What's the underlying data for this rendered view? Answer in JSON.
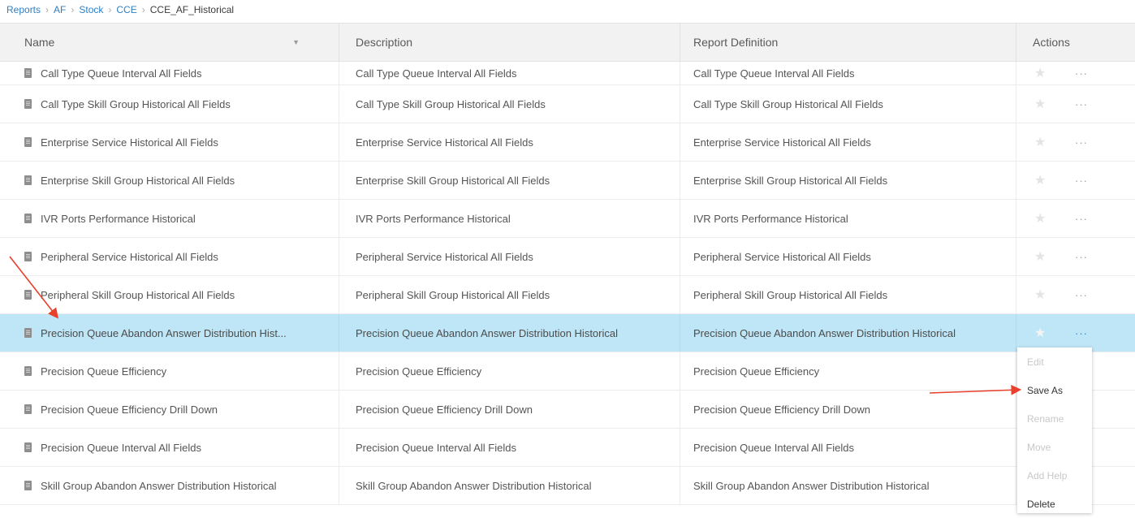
{
  "breadcrumb": {
    "items": [
      "Reports",
      "AF",
      "Stock",
      "CCE"
    ],
    "current": "CCE_AF_Historical",
    "separator": "›"
  },
  "table": {
    "headers": {
      "name": "Name",
      "description": "Description",
      "definition": "Report Definition",
      "actions": "Actions"
    },
    "rows": [
      {
        "name": "Call Type Queue Interval All Fields",
        "description": "Call Type Queue Interval All Fields",
        "definition": "Call Type Queue Interval All Fields"
      },
      {
        "name": "Call Type Skill Group Historical All Fields",
        "description": "Call Type Skill Group Historical All Fields",
        "definition": "Call Type Skill Group Historical All Fields"
      },
      {
        "name": "Enterprise Service Historical All Fields",
        "description": "Enterprise Service Historical All Fields",
        "definition": "Enterprise Service Historical All Fields"
      },
      {
        "name": "Enterprise Skill Group Historical All Fields",
        "description": "Enterprise Skill Group Historical All Fields",
        "definition": "Enterprise Skill Group Historical All Fields"
      },
      {
        "name": "IVR Ports Performance Historical",
        "description": "IVR Ports Performance Historical",
        "definition": "IVR Ports Performance Historical"
      },
      {
        "name": "Peripheral Service Historical All Fields",
        "description": "Peripheral Service Historical All Fields",
        "definition": "Peripheral Service Historical All Fields"
      },
      {
        "name": "Peripheral Skill Group Historical All Fields",
        "description": "Peripheral Skill Group Historical All Fields",
        "definition": "Peripheral Skill Group Historical All Fields"
      },
      {
        "name": "Precision Queue Abandon Answer Distribution Hist...",
        "description": "Precision Queue Abandon Answer Distribution Historical",
        "definition": "Precision Queue Abandon Answer Distribution Historical"
      },
      {
        "name": "Precision Queue Efficiency",
        "description": "Precision Queue Efficiency",
        "definition": "Precision Queue Efficiency"
      },
      {
        "name": "Precision Queue Efficiency Drill Down",
        "description": "Precision Queue Efficiency Drill Down",
        "definition": "Precision Queue Efficiency Drill Down"
      },
      {
        "name": "Precision Queue Interval All Fields",
        "description": "Precision Queue Interval All Fields",
        "definition": "Precision Queue Interval All Fields"
      },
      {
        "name": "Skill Group Abandon Answer Distribution Historical",
        "description": "Skill Group Abandon Answer Distribution Historical",
        "definition": "Skill Group Abandon Answer Distribution Historical"
      }
    ],
    "star_glyph": "★",
    "more_glyph": "···"
  },
  "context_menu": {
    "items": [
      {
        "label": "Edit",
        "enabled": false
      },
      {
        "label": "Save As",
        "enabled": true
      },
      {
        "label": "Rename",
        "enabled": false
      },
      {
        "label": "Move",
        "enabled": false
      },
      {
        "label": "Add Help",
        "enabled": false
      },
      {
        "label": "Delete",
        "enabled": true
      }
    ]
  },
  "colors": {
    "link": "#2d7fc4",
    "selected_row": "#bfe6f6",
    "annotation_arrow": "#e8402a"
  }
}
